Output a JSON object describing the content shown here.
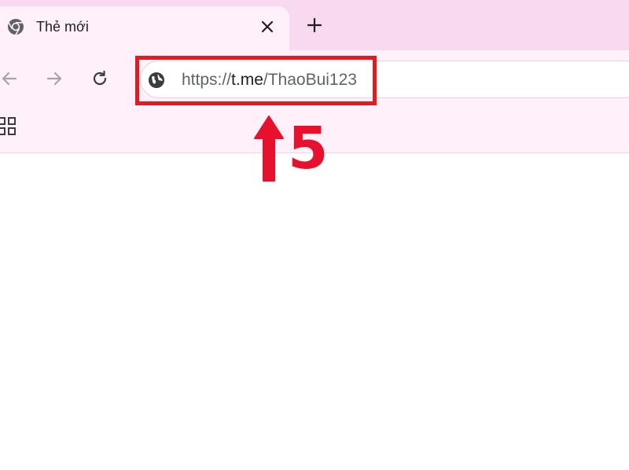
{
  "tab": {
    "title": "Thẻ mới",
    "icon": "chrome-icon",
    "close_icon": "close-icon"
  },
  "toolbar": {
    "new_tab_icon": "plus-icon",
    "back_icon": "arrow-left-icon",
    "forward_icon": "arrow-right-icon",
    "reload_icon": "reload-icon",
    "apps_icon": "apps-grid-icon"
  },
  "omnibox": {
    "site_icon": "globe-icon",
    "url_scheme": "https://",
    "url_host": "t.me",
    "url_path": "/ThaoBui123"
  },
  "annotation": {
    "step_number": "5",
    "color": "#e11b22"
  }
}
